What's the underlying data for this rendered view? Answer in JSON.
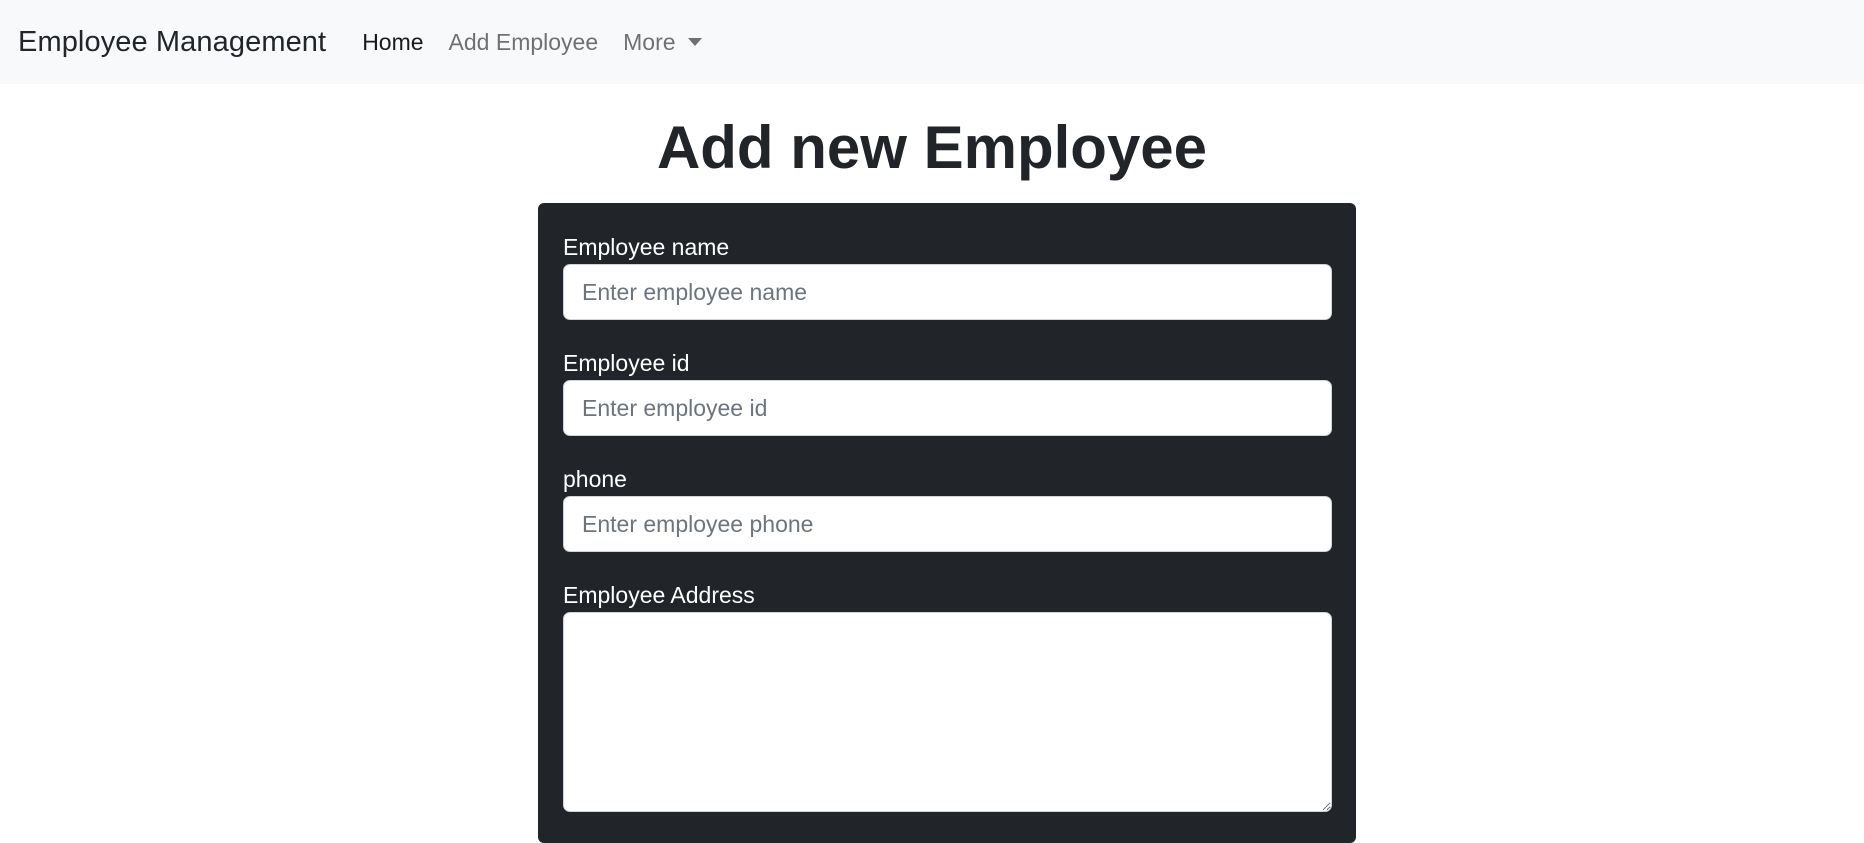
{
  "navbar": {
    "brand": "Employee Management",
    "links": [
      {
        "label": "Home",
        "active": true
      },
      {
        "label": "Add Employee",
        "active": false
      },
      {
        "label": "More",
        "active": false,
        "dropdown": true
      }
    ],
    "dropdown_icon": "chevron-down-icon"
  },
  "page": {
    "title": "Add new Employee"
  },
  "form": {
    "name": {
      "label": "Employee name",
      "placeholder": "Enter employee name",
      "value": ""
    },
    "id": {
      "label": "Employee id",
      "placeholder": "Enter employee id",
      "value": ""
    },
    "phone": {
      "label": "phone",
      "placeholder": "Enter employee phone",
      "value": ""
    },
    "address": {
      "label": "Employee Address",
      "value": ""
    }
  },
  "colors": {
    "navbar_bg": "#f8f9fa",
    "card_bg": "#212529",
    "text_dark": "#212529",
    "placeholder": "#6c757d"
  }
}
